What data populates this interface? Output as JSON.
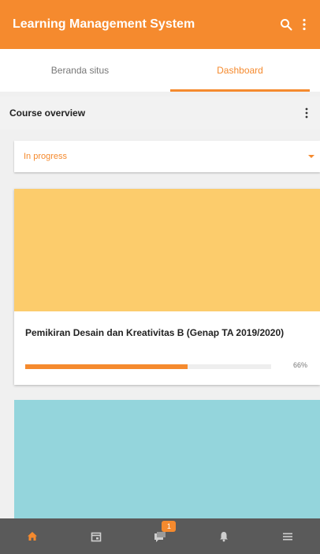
{
  "app": {
    "title": "Learning Management System"
  },
  "appbar": {
    "search_icon": "search-icon",
    "more_icon": "more-vert-icon"
  },
  "tabs": [
    {
      "label": "Beranda situs",
      "active": false
    },
    {
      "label": "Dashboard",
      "active": true
    }
  ],
  "course_overview": {
    "title": "Course overview",
    "filter": {
      "selected": "In progress"
    },
    "courses": [
      {
        "name": "Pemikiran Desain dan Kreativitas B (Genap TA 2019/2020)",
        "image_color": "#fccc6c",
        "progress_percent": 66,
        "progress_label": "66%"
      },
      {
        "name": "",
        "image_color": "#94d5dc"
      }
    ]
  },
  "bottom_nav": {
    "items": [
      {
        "icon": "home-icon",
        "active": true
      },
      {
        "icon": "calendar-icon",
        "active": false
      },
      {
        "icon": "messages-icon",
        "active": false,
        "badge": "1"
      },
      {
        "icon": "notifications-icon",
        "active": false
      },
      {
        "icon": "menu-icon",
        "active": false
      }
    ]
  },
  "colors": {
    "accent": "#f58a2e",
    "bottom_nav_bg": "#5a5a5a",
    "inactive_icon": "#cfcfcf"
  }
}
